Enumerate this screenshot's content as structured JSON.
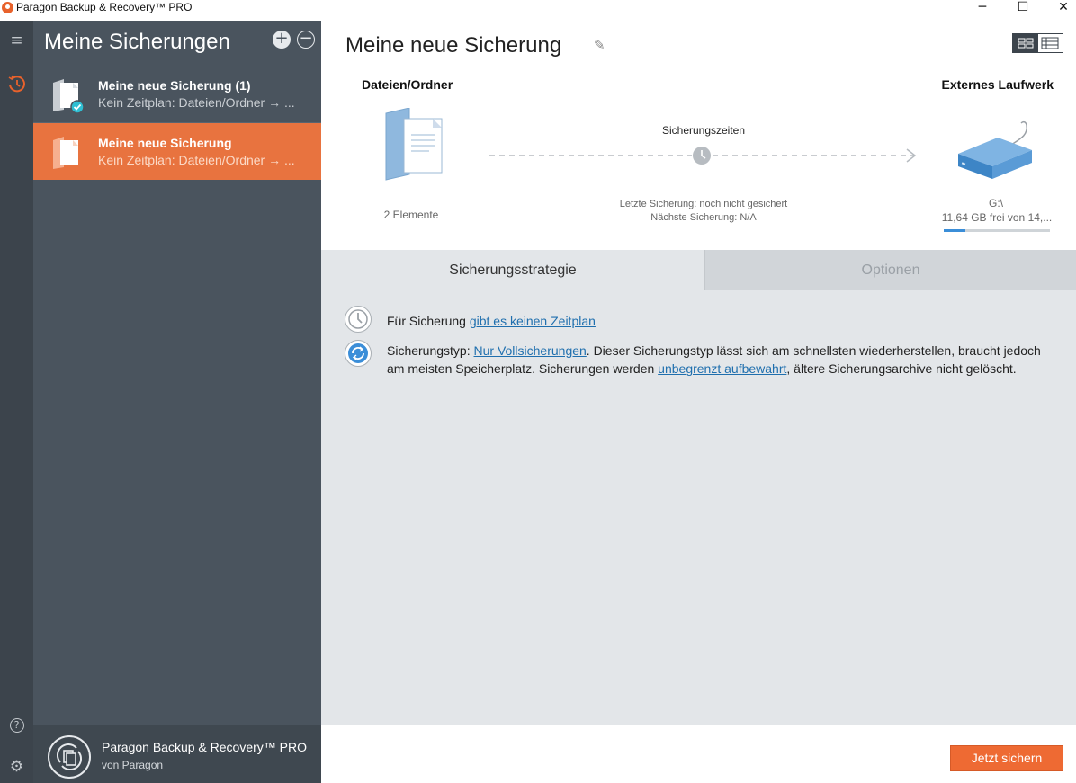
{
  "window": {
    "title": "Paragon Backup & Recovery™ PRO",
    "min_glyph": "─",
    "max_glyph": "☐",
    "close_glyph": "✕"
  },
  "rail": {
    "icons": [
      "menu-icon",
      "clock-icon",
      "help-icon",
      "gear-icon"
    ],
    "menu_glyph": "≡",
    "help_glyph": "?",
    "gear_glyph": "⚙"
  },
  "sidebar": {
    "title": "Meine Sicherungen",
    "add_glyph": "+",
    "remove_glyph": "−",
    "jobs": [
      {
        "name": "Meine neue Sicherung (1)",
        "subtitle": "Kein Zeitplan: Dateien/Ordner → ..."
      },
      {
        "name": "Meine neue Sicherung",
        "subtitle": "Kein Zeitplan: Dateien/Ordner → ..."
      }
    ],
    "footer": {
      "product": "Paragon Backup & Recovery™ PRO",
      "vendor": "von Paragon"
    }
  },
  "main": {
    "job_title": "Meine neue Sicherung",
    "edit_glyph": "✎",
    "source": {
      "label": "Dateien/Ordner",
      "count": "2 Elemente"
    },
    "schedule": {
      "title": "Sicherungszeiten",
      "last": "Letzte Sicherung: noch nicht gesichert",
      "next": "Nächste Sicherung: N/A"
    },
    "destination": {
      "label": "Externes Laufwerk",
      "drive": "G:\\",
      "free": "11,64 GB frei von 14,...",
      "usage_fraction": 0.2
    },
    "tabs": [
      "Sicherungsstrategie",
      "Optionen"
    ],
    "strategy": {
      "row1_prefix": "Für Sicherung ",
      "row1_link": "gibt es keinen Zeitplan",
      "row2_prefix": "Sicherungstyp: ",
      "row2_link1": "Nur Vollsicherungen",
      "row2_mid": ". Dieser Sicherungstyp lässt sich am schnellsten wiederherstellen, braucht jedoch am meisten Speicherplatz. Sicherungen werden ",
      "row2_link2": "unbegrenzt aufbewahrt",
      "row2_suffix": ", ältere Sicherungsarchive nicht gelöscht."
    },
    "action_button": "Jetzt sichern"
  },
  "colors": {
    "accent": "#ee6a33",
    "sidebar": "#4a545e",
    "rail": "#3c444c",
    "link": "#1f6fae",
    "panel": "#e3e6e9"
  }
}
